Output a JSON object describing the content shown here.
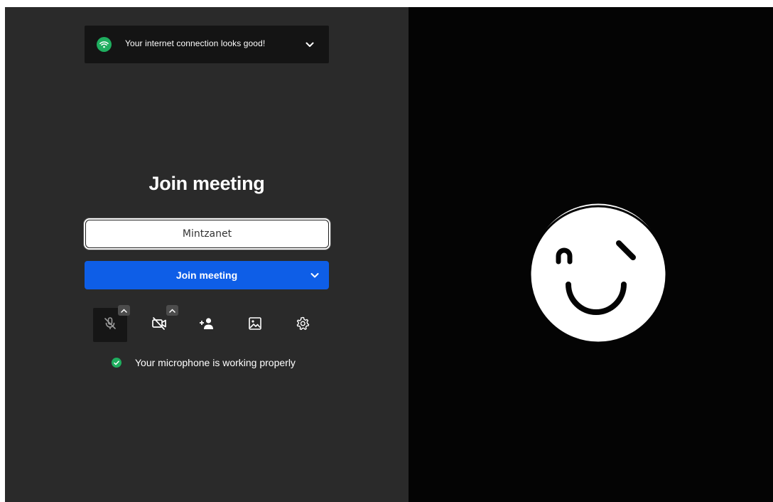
{
  "connection": {
    "message": "Your internet connection looks good!",
    "status_color": "#1fae5f",
    "icon": "wifi-icon",
    "expand_icon": "chevron-down-icon"
  },
  "prejoin": {
    "title": "Join meeting",
    "name_value": "Mintzanet",
    "name_placeholder": "",
    "join_label": "Join meeting",
    "join_color": "#0e5ee7"
  },
  "toolbar": {
    "items": [
      {
        "id": "mic",
        "icon": "microphone-muted-icon",
        "has_options": true
      },
      {
        "id": "camera",
        "icon": "camera-off-icon",
        "has_options": true
      },
      {
        "id": "invite",
        "icon": "add-person-icon",
        "has_options": false
      },
      {
        "id": "background",
        "icon": "image-icon",
        "has_options": false
      },
      {
        "id": "settings",
        "icon": "gear-icon",
        "has_options": false
      }
    ]
  },
  "mic_check": {
    "message": "Your microphone is working properly",
    "status_color": "#1fae5f"
  },
  "preview": {
    "avatar_icon": "winking-face-icon"
  }
}
